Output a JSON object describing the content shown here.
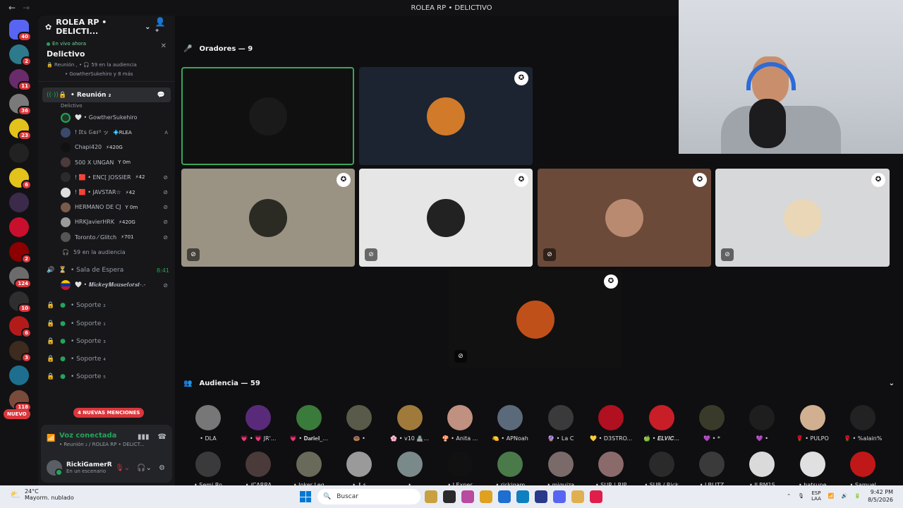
{
  "window": {
    "title": "ROLEA RP  • DELICTIVO",
    "back": "←",
    "forward": "→"
  },
  "rail": {
    "servers": [
      {
        "color": "#5865f2",
        "badge": "40"
      },
      {
        "color": "#2c7a8c",
        "badge": "2"
      },
      {
        "color": "#6a2b6a",
        "badge": "11"
      },
      {
        "color": "#7a7a7a",
        "badge": "36"
      },
      {
        "color": "#e2c21b",
        "badge": "23"
      },
      {
        "color": "#222222",
        "badge": ""
      },
      {
        "color": "#e2c21b",
        "badge": "6"
      },
      {
        "color": "#3b2a4a",
        "badge": ""
      },
      {
        "color": "#c8102e",
        "badge": ""
      },
      {
        "color": "#8b0000",
        "badge": "2"
      },
      {
        "color": "#6b6b6b",
        "badge": "124"
      },
      {
        "color": "#2e2e2e",
        "badge": "10"
      },
      {
        "color": "#b31b1b",
        "badge": "6"
      },
      {
        "color": "#3d2b1f",
        "badge": "3"
      },
      {
        "color": "#1e6f8f",
        "badge": ""
      },
      {
        "color": "#7a4a3a",
        "badge": "118"
      }
    ],
    "new_label": "NUEVO"
  },
  "sidebar": {
    "guild_name": "ROLEA RP  • DELICTI...",
    "stage": {
      "live": "En vivo ahora",
      "title": "Delictivo",
      "info": "🔒 Reunión ,  • 🎧 59 en la audiencia",
      "speakers": "• GowtherSukehiro y 8 más"
    },
    "active_channel": {
      "name": "• Reunión ₂",
      "sub": "Delictivo"
    },
    "members": [
      {
        "name": "🤍 • GowtherSukehiro",
        "tag": "",
        "color": "#1e3a24",
        "mute": ""
      },
      {
        "name": "! 𝕀𝕥𝕤 𝔾𝕠𝕣² ッ",
        "tag": "💠RLEA",
        "color": "#3b4a6b",
        "mute": "ʌ"
      },
      {
        "name": "Chapi420",
        "tag": "⚡420G",
        "color": "#111111",
        "mute": ""
      },
      {
        "name": "500 X UNGAN",
        "tag": "Y 0m",
        "color": "#4b3b3b",
        "mute": ""
      },
      {
        "name": "! 🟥 • ENC[ JOSSIER",
        "tag": "⚡42",
        "color": "#2b2b2b",
        "mute": "⊘"
      },
      {
        "name": "! 🟥 • JAVSTAR☆",
        "tag": "⚡42",
        "color": "#dddddd",
        "mute": "⊘"
      },
      {
        "name": "HERMANO DE CJ",
        "tag": "Y 0m",
        "color": "#7a5a4a",
        "mute": "⊘"
      },
      {
        "name": "HRKJavierHRK",
        "tag": "⚡420G",
        "color": "#9a9a9a",
        "mute": "⊘"
      },
      {
        "name": "Toronto ⁄ Glitch",
        "tag": "⚡701",
        "color": "#555555",
        "mute": "⊘"
      }
    ],
    "audience_count": "59 en la audiencia",
    "waiting": {
      "name": "• Sala de Espera",
      "time": "8:41",
      "member": "🤍 • 𝑴𝒊𝒄𝒌𝒆𝒚𝑴𝒐𝒖𝒔𝒆𝒇𝒐𝒓𝒔𝒕-.-"
    },
    "support": [
      "• Soporte ₂",
      "• Soporte ₁",
      "• Soporte ₃",
      "• Soporte ₄",
      "• Soporte ₅"
    ],
    "mentions": "4 NUEVAS MENCIONES",
    "voice": {
      "status": "Voz conectada",
      "channel": "• Reunión ₂ / ROLEA RP  • DELICT..."
    },
    "user": {
      "name": "RickiGamerR",
      "status": "En un escenario"
    }
  },
  "stage": {
    "speakers_title": "Oradores — 9",
    "audience_title": "Audiencia — 59",
    "tiles": [
      {
        "bg": "#101010",
        "avatar": "#1a1a1a",
        "mod": false,
        "muted": false,
        "speaking": true
      },
      {
        "bg": "#1b2430",
        "avatar": "#d07a2a",
        "mod": true,
        "muted": false,
        "speaking": false
      },
      {
        "bg": "#0f0f11",
        "avatar": "#0f0f11",
        "mod": false,
        "muted": false,
        "speaking": false
      },
      {
        "bg": "#9a9384",
        "avatar": "#2b2b24",
        "mod": true,
        "muted": true,
        "speaking": false
      },
      {
        "bg": "#e6e6e6",
        "avatar": "#222222",
        "mod": true,
        "muted": true,
        "speaking": false
      },
      {
        "bg": "#6b4a3a",
        "avatar": "#b98a70",
        "mod": true,
        "muted": true,
        "speaking": false
      },
      {
        "bg": "#d6d8da",
        "avatar": "#e9d7b8",
        "mod": true,
        "muted": true,
        "speaking": false
      },
      {
        "bg": "#111111",
        "avatar": "#c0501a",
        "mod": true,
        "muted": true,
        "speaking": false
      }
    ],
    "audience": [
      {
        "name": "• DLA",
        "color": "#777777"
      },
      {
        "name": "💗 • 💗 JR'...",
        "color": "#5a2a7a"
      },
      {
        "name": "💗 • 𝐃𝐚𝐫𝐢𝐞𝐥_...",
        "color": "#3a7a3a"
      },
      {
        "name": "🍩 •",
        "color": "#5a5a4a"
      },
      {
        "name": "🌸 • v10 🏯...",
        "color": "#a07a3a"
      },
      {
        "name": "🍄 • Anita ...",
        "color": "#c09080"
      },
      {
        "name": "🍋 • APNoah",
        "color": "#5a6a7a"
      },
      {
        "name": "🔮 • La C",
        "color": "#3a3a3a"
      },
      {
        "name": "💛 • D3STRO...",
        "color": "#b01020"
      },
      {
        "name": "🍏 • 𝑬𝑳𝑽𝑰𝑪...",
        "color": "#c81e28"
      },
      {
        "name": "💜 • *",
        "color": "#3a3a2a"
      },
      {
        "name": "💜 •",
        "color": "#1e1e1e"
      },
      {
        "name": "🌹 • PULPO",
        "color": "#d0b090"
      },
      {
        "name": "🌹 • %alain%",
        "color": "#222222"
      },
      {
        "name": "• Semi Ro",
        "color": "#3a3a3a"
      },
      {
        "name": "• /CARRA",
        "color": "#4a3a3a"
      },
      {
        "name": "• Joker Leg",
        "color": "#6a6a5a"
      },
      {
        "name": "• 𝐉 ⚡",
        "color": "#9a9a9a"
      },
      {
        "name": "• ",
        "color": "#7a8a8a"
      },
      {
        "name": "• J Exper",
        "color": "#111111"
      },
      {
        "name": "• rickigam",
        "color": "#4a7a4a"
      },
      {
        "name": "• miquiza",
        "color": "#7a6a6a"
      },
      {
        "name": "• SUR | RIP",
        "color": "#8a6a6a"
      },
      {
        "name": "• SUB / Rick",
        "color": "#2a2a2a"
      },
      {
        "name": "• LBLITZ",
        "color": "#3a3a3a"
      },
      {
        "name": "• JLBM1S",
        "color": "#dadada"
      },
      {
        "name": "• hatsune",
        "color": "#e0e0e0"
      },
      {
        "name": "• Samuel",
        "color": "#c01818"
      }
    ]
  },
  "taskbar": {
    "temp": "24°C",
    "weather": "Mayorm. nublado",
    "search_placeholder": "Buscar",
    "lang": "ESP",
    "lang2": "LAA",
    "time": "9:42 PM",
    "date": "8/5/2026",
    "apps": [
      "#c8a040",
      "#2a2a2a",
      "#b84aa0",
      "#e0a020",
      "#1e6fd0",
      "#0f7fbf",
      "#2a3a8a",
      "#5865f2",
      "#e0b050",
      "#e01e4a"
    ]
  }
}
